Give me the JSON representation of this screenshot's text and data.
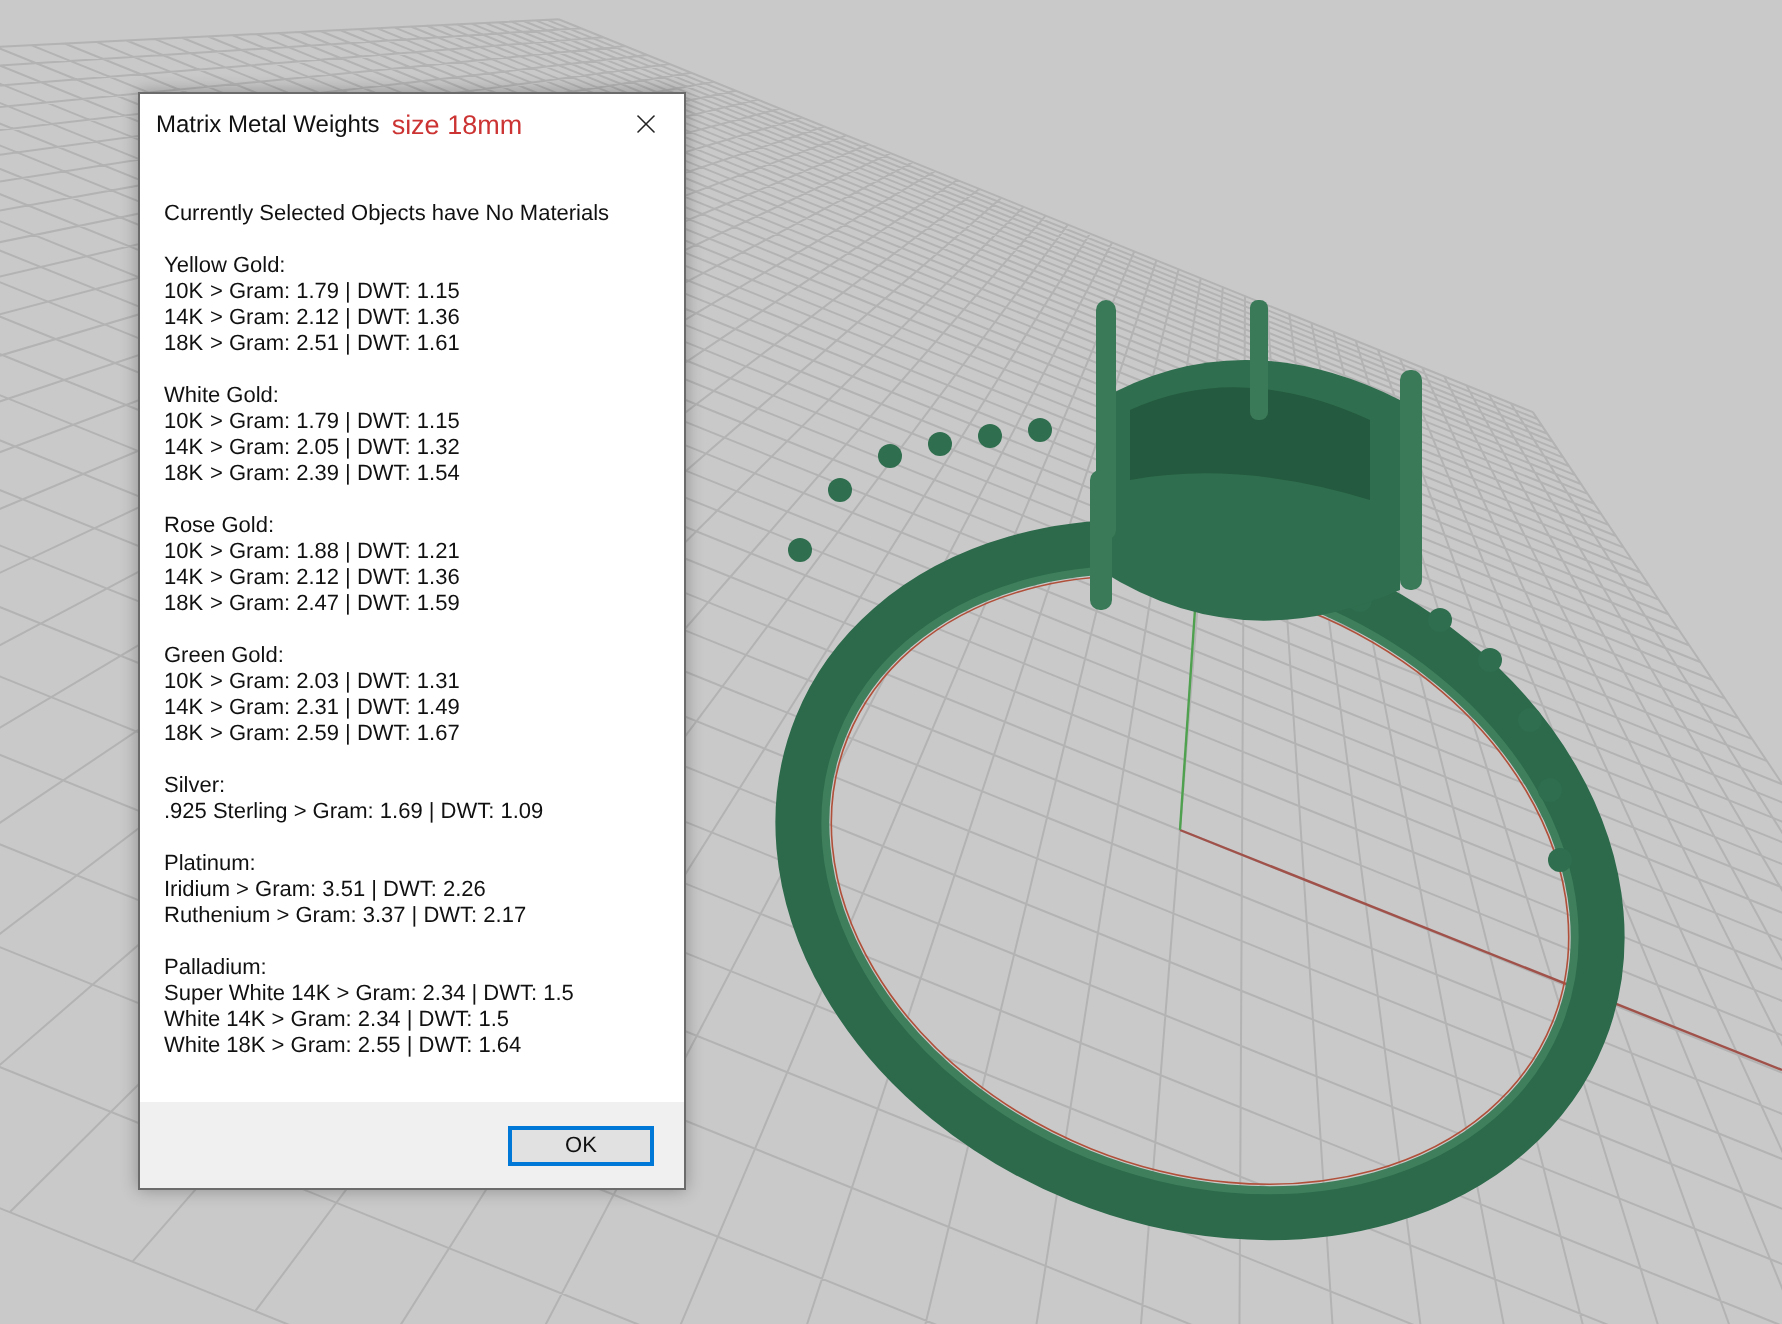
{
  "window": {
    "title": "Matrix Metal Weights",
    "size_note": "size 18mm"
  },
  "message": "Currently Selected Objects have No Materials",
  "groups": [
    {
      "name": "Yellow Gold:",
      "lines": [
        {
          "kind": "tabbed",
          "label": "10K",
          "value": "> Gram: 1.79 | DWT: 1.15"
        },
        {
          "kind": "tabbed",
          "label": "14K",
          "value": "> Gram: 2.12 | DWT: 1.36"
        },
        {
          "kind": "tabbed",
          "label": "18K",
          "value": "> Gram: 2.51 | DWT: 1.61"
        }
      ]
    },
    {
      "name": "White Gold:",
      "lines": [
        {
          "kind": "tabbed",
          "label": "10K",
          "value": "> Gram: 1.79 | DWT: 1.15"
        },
        {
          "kind": "tabbed",
          "label": "14K",
          "value": "> Gram: 2.05 | DWT: 1.32"
        },
        {
          "kind": "tabbed",
          "label": "18K",
          "value": "> Gram: 2.39 | DWT: 1.54"
        }
      ]
    },
    {
      "name": "Rose Gold:",
      "lines": [
        {
          "kind": "tabbed",
          "label": "10K",
          "value": "> Gram: 1.88 | DWT: 1.21"
        },
        {
          "kind": "tabbed",
          "label": "14K",
          "value": "> Gram: 2.12 | DWT: 1.36"
        },
        {
          "kind": "tabbed",
          "label": "18K",
          "value": "> Gram: 2.47 | DWT: 1.59"
        }
      ]
    },
    {
      "name": "Green Gold:",
      "lines": [
        {
          "kind": "tabbed",
          "label": "10K",
          "value": "> Gram: 2.03 | DWT: 1.31"
        },
        {
          "kind": "tabbed",
          "label": "14K",
          "value": "> Gram: 2.31 | DWT: 1.49"
        },
        {
          "kind": "tabbed",
          "label": "18K",
          "value": "> Gram: 2.59 | DWT: 1.67"
        }
      ]
    },
    {
      "name": "Silver:",
      "lines": [
        {
          "kind": "plain",
          "value": ".925 Sterling > Gram: 1.69 | DWT: 1.09"
        }
      ]
    },
    {
      "name": "Platinum:",
      "lines": [
        {
          "kind": "plain",
          "value": "Iridium > Gram: 3.51 | DWT: 2.26"
        },
        {
          "kind": "plain",
          "value": "Ruthenium > Gram: 3.37 | DWT: 2.17"
        }
      ]
    },
    {
      "name": "Palladium:",
      "lines": [
        {
          "kind": "plain",
          "value": "Super White 14K > Gram: 2.34 | DWT: 1.5"
        },
        {
          "kind": "plain",
          "value": "White 14K > Gram: 2.34 | DWT: 1.5"
        },
        {
          "kind": "plain",
          "value": "White 18K > Gram: 2.55 | DWT: 1.64"
        }
      ]
    }
  ],
  "buttons": [
    "OK"
  ]
}
